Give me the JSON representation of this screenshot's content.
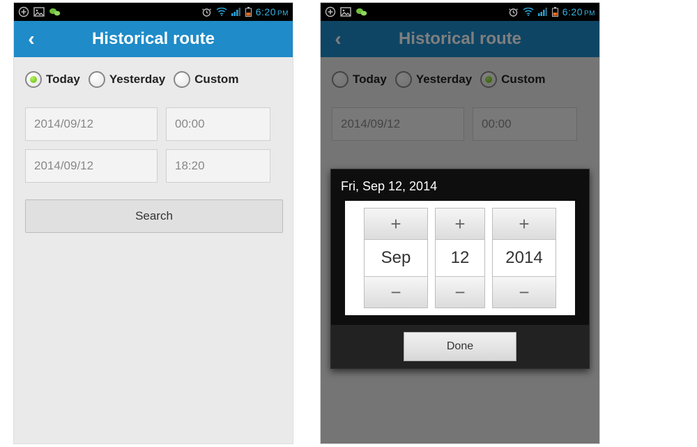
{
  "statusbar": {
    "time": "6:20",
    "ampm": "PM"
  },
  "appbar": {
    "title": "Historical route",
    "back_glyph": "‹"
  },
  "radios": {
    "today": "Today",
    "yesterday": "Yesterday",
    "custom": "Custom"
  },
  "screen1": {
    "selected_radio": "today",
    "start_date": "2014/09/12",
    "start_time": "00:00",
    "end_date": "2014/09/12",
    "end_time": "18:20",
    "search_label": "Search"
  },
  "screen2": {
    "selected_radio": "custom",
    "start_date": "2014/09/12",
    "start_time": "00:00",
    "dialog_title": "Fri, Sep 12, 2014",
    "picker_month": "Sep",
    "picker_day": "12",
    "picker_year": "2014",
    "plus": "+",
    "minus": "−",
    "done_label": "Done"
  }
}
